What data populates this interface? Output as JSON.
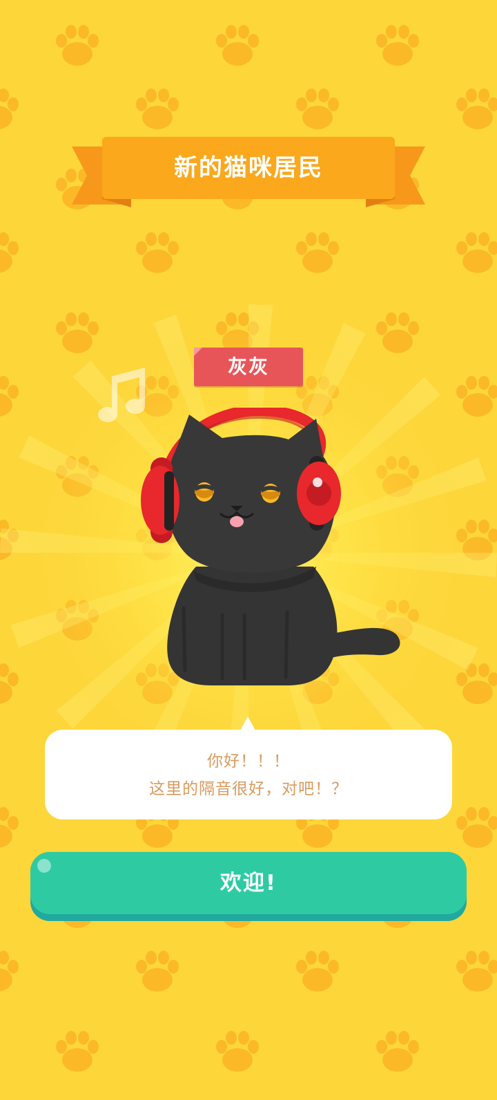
{
  "banner": {
    "title": "新的猫咪居民"
  },
  "cat": {
    "name": "灰灰"
  },
  "dialog": {
    "line1": "你好！！！",
    "line2": "这里的隔音很好，对吧！？"
  },
  "actions": {
    "welcome_label": "欢迎!"
  },
  "icons": {
    "background": "paw-print-icon",
    "decoration": "music-note-icon",
    "character": "black-cat-with-headphones"
  },
  "colors": {
    "background": "#FDD63A",
    "paw": "#FBB928",
    "banner": "#FBA81C",
    "name_tag": "#E85558",
    "button": "#2ECBA3",
    "dialog_text": "#D99A5E"
  }
}
